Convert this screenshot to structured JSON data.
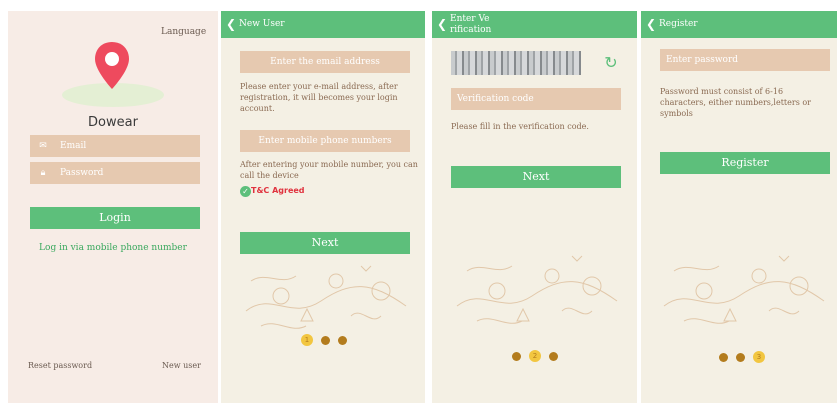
{
  "login": {
    "language": "Language",
    "app_name": "Dowear",
    "email_placeholder": "Email",
    "password_placeholder": "Password",
    "login_button": "Login",
    "mobile_login_link": "Log in via mobile phone number",
    "reset_password": "Reset password",
    "new_user": "New user"
  },
  "new_user": {
    "title": "New User",
    "email_placeholder": "Enter the email address",
    "email_hint": "Please enter your e-mail address, after registration, it will becomes your login account.",
    "phone_placeholder": "Enter mobile phone numbers",
    "phone_hint": "After entering your mobile number, you can call the device",
    "tc_label": "T&C Agreed",
    "next_button": "Next",
    "steps": [
      "1",
      "2",
      "3"
    ],
    "active_step": 1
  },
  "verify": {
    "title": "Enter Ve\nrification",
    "title_line1": "Enter Ve",
    "title_line2": "rification",
    "code_placeholder": "Verification code",
    "code_hint": "Please fill in the verification code.",
    "next_button": "Next",
    "steps": [
      "1",
      "2",
      "3"
    ],
    "active_step": 2
  },
  "register": {
    "title": "Register",
    "password_placeholder": "Enter password",
    "password_hint": "Password must consist of 6-16 characters, either numbers,letters or symbols",
    "register_button": "Register",
    "steps": [
      "1",
      "2",
      "3"
    ],
    "active_step": 3
  },
  "colors": {
    "green": "#5dbf7b",
    "field": "#e6c9b0",
    "pin_red": "#ee4a5e",
    "dot_gold": "#b37c1d",
    "dot_active": "#f2c640",
    "tc_red": "#e0323e"
  }
}
